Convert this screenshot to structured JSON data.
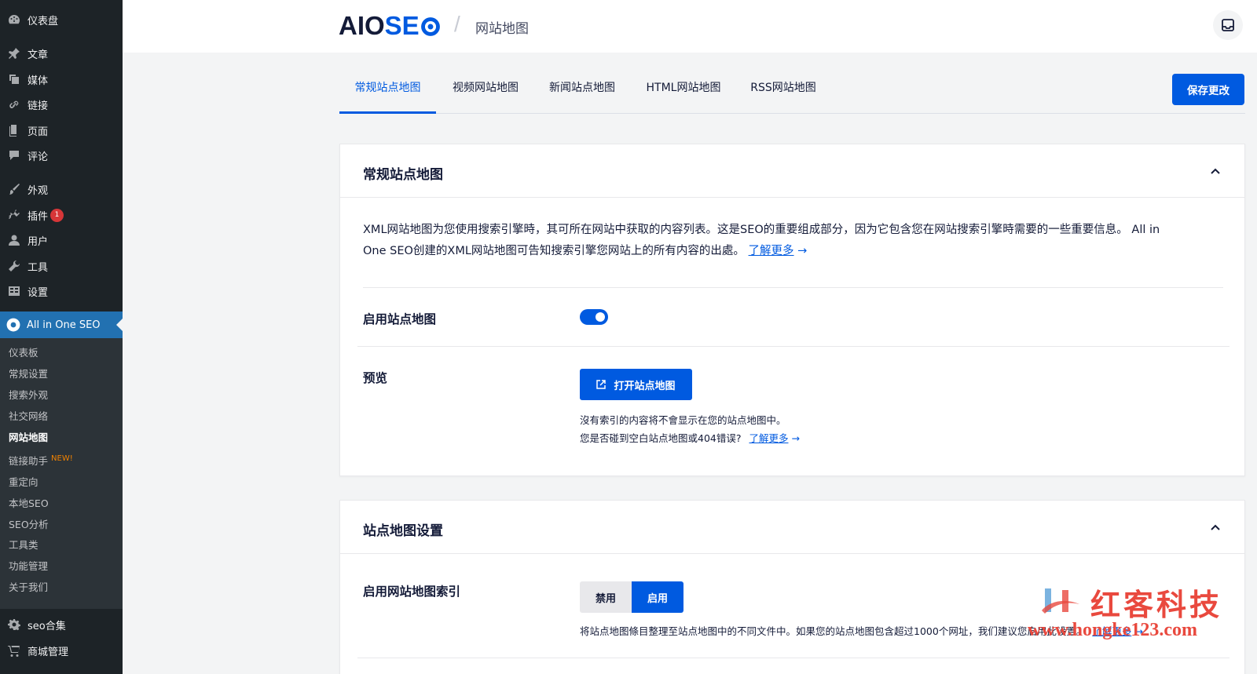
{
  "sidebar": {
    "items": [
      {
        "label": "仪表盘",
        "icon": "dashboard-icon"
      },
      {
        "label": "文章",
        "icon": "pin-icon"
      },
      {
        "label": "媒体",
        "icon": "media-icon"
      },
      {
        "label": "链接",
        "icon": "link-icon"
      },
      {
        "label": "页面",
        "icon": "page-icon"
      },
      {
        "label": "评论",
        "icon": "comment-icon"
      },
      {
        "label": "外观",
        "icon": "brush-icon"
      },
      {
        "label": "插件",
        "icon": "plugin-icon",
        "badge": "1"
      },
      {
        "label": "用户",
        "icon": "user-icon"
      },
      {
        "label": "工具",
        "icon": "wrench-icon"
      },
      {
        "label": "设置",
        "icon": "settings-icon"
      }
    ],
    "active": {
      "label": "All in One SEO",
      "icon": "aioseo-gear-icon"
    },
    "submenu": [
      {
        "label": "仪表板"
      },
      {
        "label": "常规设置"
      },
      {
        "label": "搜索外观"
      },
      {
        "label": "社交网络"
      },
      {
        "label": "网站地图",
        "active": true
      },
      {
        "label": "链接助手",
        "tag": "NEW!"
      },
      {
        "label": "重定向"
      },
      {
        "label": "本地SEO"
      },
      {
        "label": "SEO分析"
      },
      {
        "label": "工具类"
      },
      {
        "label": "功能管理"
      },
      {
        "label": "关于我们"
      }
    ],
    "bottom": [
      {
        "label": "seo合集",
        "icon": "gear-icon"
      },
      {
        "label": "商城管理",
        "icon": "cart-icon"
      }
    ]
  },
  "header": {
    "logo_aio": "AIO",
    "logo_seo": "SE",
    "separator": "/",
    "title": "网站地图"
  },
  "tabs": [
    {
      "label": "常规站点地图",
      "active": true
    },
    {
      "label": "视频网站地图"
    },
    {
      "label": "新闻站点地图"
    },
    {
      "label": "HTML网站地图"
    },
    {
      "label": "RSS网站地图"
    }
  ],
  "save_label": "保存更改",
  "card1": {
    "title": "常规站点地图",
    "desc_line1": "XML网站地图为您使用搜索引擎時，其可所在网站中获取的内容列表。这是SEO的重要组成部分，因为它包含您在网站搜索引擎時需要的一些重要信息。 All in",
    "desc_line2": "One SEO创建的XML网站地图可告知搜索引擎您网站上的所有内容的出處。",
    "learn_more": "了解更多",
    "arrow": "→",
    "enable_label": "启用站点地图",
    "enable_value": true,
    "preview_label": "预览",
    "open_button": "打开站点地图",
    "note1": "沒有索引的内容将不會显示在您的站点地图中。",
    "note2": "您是否碰到空白站点地图或404错误?",
    "note2_link": "了解更多"
  },
  "card2": {
    "title": "站点地图设置",
    "index_label": "启用网站地图索引",
    "disable_label": "禁用",
    "enable_label": "启用",
    "selected": "启用",
    "note": "将站点地图條目整理至站点地图中的不同文件中。如果您的站点地图包含超过1000个网址，我们建议您启用此设置。",
    "note_link": "了解更多"
  },
  "watermark": {
    "text": "红客科技",
    "url": "www.hongke123.com"
  },
  "colors": {
    "sidebar_bg": "#1d2327",
    "sidebar_active": "#2271b1",
    "accent": "#005ae0",
    "badge": "#d63638",
    "new_tag": "#f18200",
    "watermark": "#e9493e"
  }
}
